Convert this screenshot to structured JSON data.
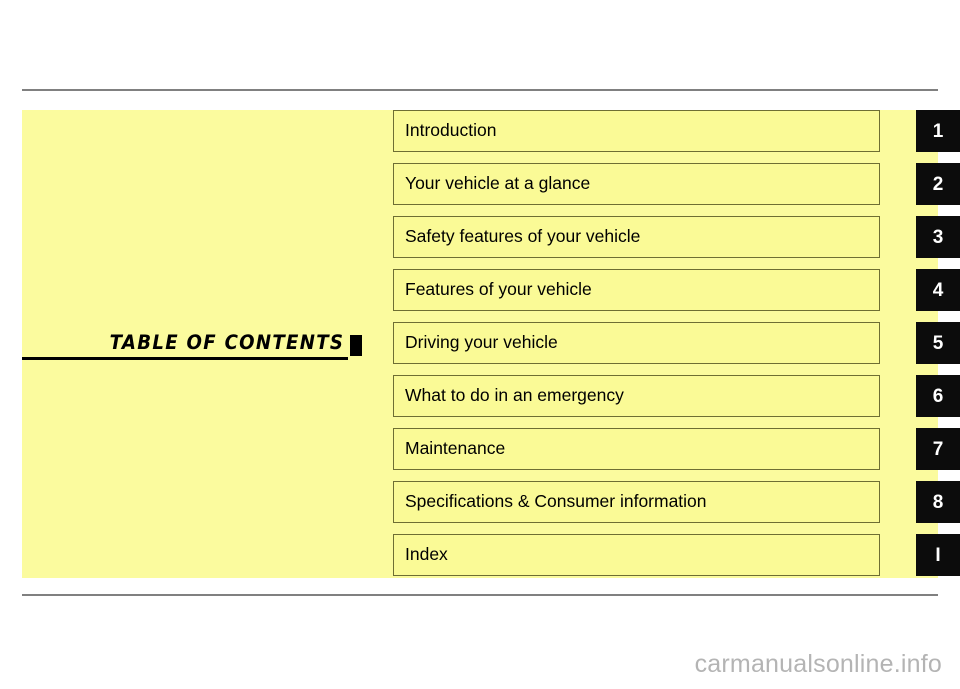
{
  "document": {
    "title": "TABLE OF CONTENTS",
    "title_marker": "black-square",
    "watermark": "carmanualsonline.info"
  },
  "colors": {
    "panel_background": "#fbfb9e",
    "row_background": "#fafa96",
    "row_border": "#6e6e33",
    "tab_background": "#0c0c0c",
    "tab_text": "#ffffff",
    "rule": "#808080",
    "watermark": "#b4b4b4",
    "page_background": "#ffffff"
  },
  "toc": {
    "rows": [
      {
        "label": "Introduction",
        "tab": "1"
      },
      {
        "label": "Your vehicle at a glance",
        "tab": "2"
      },
      {
        "label": "Safety features of your vehicle",
        "tab": "3"
      },
      {
        "label": "Features of your vehicle",
        "tab": "4"
      },
      {
        "label": "Driving your vehicle",
        "tab": "5"
      },
      {
        "label": "What to do in an emergency",
        "tab": "6"
      },
      {
        "label": "Maintenance",
        "tab": "7"
      },
      {
        "label": "Specifications & Consumer information",
        "tab": "8"
      },
      {
        "label": "Index",
        "tab": "I"
      }
    ]
  }
}
